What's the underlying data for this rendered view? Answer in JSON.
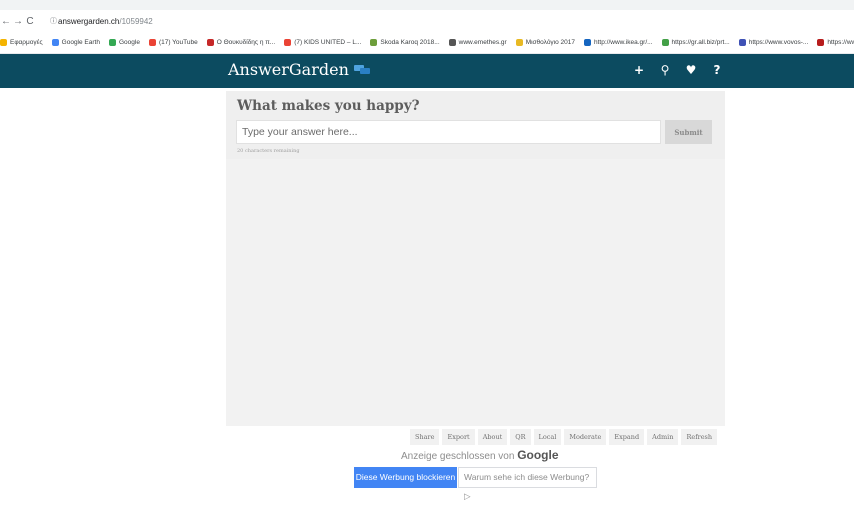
{
  "browser": {
    "nav": {
      "back": "←",
      "forward": "→",
      "reload": "C"
    },
    "url_host": "answergarden.ch",
    "url_path": "/1059942",
    "bookmarks": [
      {
        "label": "Εφαρμογές",
        "color": "#f4b400"
      },
      {
        "label": "Google Earth",
        "color": "#4285f4"
      },
      {
        "label": "Google",
        "color": "#34a853"
      },
      {
        "label": "(17) YouTube",
        "color": "#ea4335"
      },
      {
        "label": "Ο Θουκυδίδης η π...",
        "color": "#c62828"
      },
      {
        "label": "(7) KIDS UNITED – L...",
        "color": "#ea4335"
      },
      {
        "label": "Skoda Karoq 2018...",
        "color": "#6d9e3b"
      },
      {
        "label": "www.emethes.gr",
        "color": "#555555"
      },
      {
        "label": "Μισθολόγιο 2017",
        "color": "#e8b923"
      },
      {
        "label": "http://www.ikea.gr/...",
        "color": "#1565c0"
      },
      {
        "label": "https://gr.all.biz/prt...",
        "color": "#43a047"
      },
      {
        "label": "https://www.vovos-...",
        "color": "#3f51b5"
      },
      {
        "label": "https://www.poli",
        "color": "#b71c1c"
      }
    ]
  },
  "header": {
    "logo": "AnswerGarden",
    "icons": [
      {
        "name": "add-icon",
        "glyph": "+"
      },
      {
        "name": "search-icon",
        "glyph": "⚲"
      },
      {
        "name": "heart-icon",
        "glyph": "♥"
      },
      {
        "name": "help-icon",
        "glyph": "?"
      }
    ],
    "color": "#0c4b60"
  },
  "main": {
    "question": "What makes you happy?",
    "input_placeholder": "Type your answer here...",
    "submit_label": "Submit",
    "remaining": "20 characters remaining"
  },
  "toolbar": [
    "Share",
    "Export",
    "About",
    "QR",
    "Local",
    "Moderate",
    "Expand",
    "Admin",
    "Refresh"
  ],
  "ad": {
    "closed_text": "Anzeige geschlossen von ",
    "google": "Google",
    "block_label": "Diese Werbung blockieren",
    "why_label": "Warum sehe ich diese Werbung? ▷"
  }
}
